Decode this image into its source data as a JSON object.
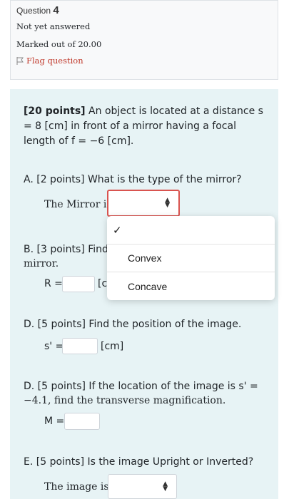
{
  "info": {
    "question_prefix": "Question",
    "question_number": "4",
    "state": "Not yet answered",
    "grade": "Marked out of 20.00",
    "flag_label": "Flag question"
  },
  "question": {
    "intro_points": "[20 points]",
    "intro_text": " An object is located at a distance s = 8 [cm] in front of a mirror having a focal length of f = −6 [cm].",
    "part_a": "A. [2 points] What is the type of the mirror?",
    "mirror_label": "The Mirror is",
    "part_b_line1": "B. [3 points] Find",
    "part_b_line2": "mirror.",
    "r_label": "R =",
    "r_unit": "[c",
    "part_d1": "D. [5 points] Find the position of the image.",
    "s_label": "s' =",
    "s_unit": "[cm]",
    "part_d2_line1": "D.  [5 points] If the location of the image is s' =",
    "part_d2_line2": "−4.1, find the transverse magnification.",
    "m_label": "M =",
    "part_e": "E. [5 points] Is the image Upright or Inverted?",
    "image_label": "The image is"
  },
  "dropdown": {
    "check": "✓",
    "options": [
      "Convex",
      "Concave"
    ]
  },
  "colors": {
    "accent_red": "#d9534f",
    "panel_bg": "#e7f3f5",
    "flag_red": "#c0392b"
  }
}
